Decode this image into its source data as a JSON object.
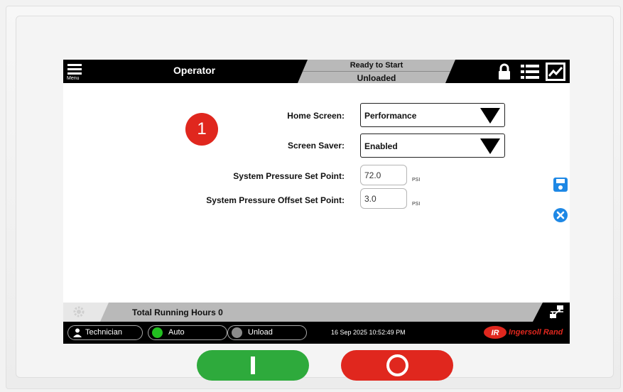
{
  "header": {
    "menu_label": "Menu",
    "title": "Operator",
    "status_line1": "Ready to Start",
    "status_line2": "Unloaded",
    "icons": [
      "lock-icon",
      "list-icon",
      "trend-chart-icon"
    ]
  },
  "badge": {
    "number": "1"
  },
  "settings": {
    "home_screen_label": "Home Screen:",
    "home_screen_value": "Performance",
    "screen_saver_label": "Screen Saver:",
    "screen_saver_value": "Enabled",
    "pressure_set_label": "System Pressure Set Point:",
    "pressure_set_value": "72.0",
    "pressure_set_unit": "PSI",
    "pressure_offset_label": "System Pressure Offset Set Point:",
    "pressure_offset_value": "3.0",
    "pressure_offset_unit": "PSI"
  },
  "side_actions": {
    "icons": [
      "save-icon",
      "cancel-icon"
    ]
  },
  "hours_bar": {
    "text": "Total Running Hours 0"
  },
  "status_bar": {
    "user": "Technician",
    "mode": "Auto",
    "load_state": "Unload",
    "datetime": "16 Sep 2025  10:52:49 PM",
    "brand": "Ingersoll Rand",
    "brand_mark": "IR"
  },
  "colors": {
    "accent_red": "#e0271e",
    "start_green": "#2eaa3c",
    "action_blue": "#1e88e5",
    "led_green": "#22c020",
    "led_gray": "#8a8a8a"
  }
}
